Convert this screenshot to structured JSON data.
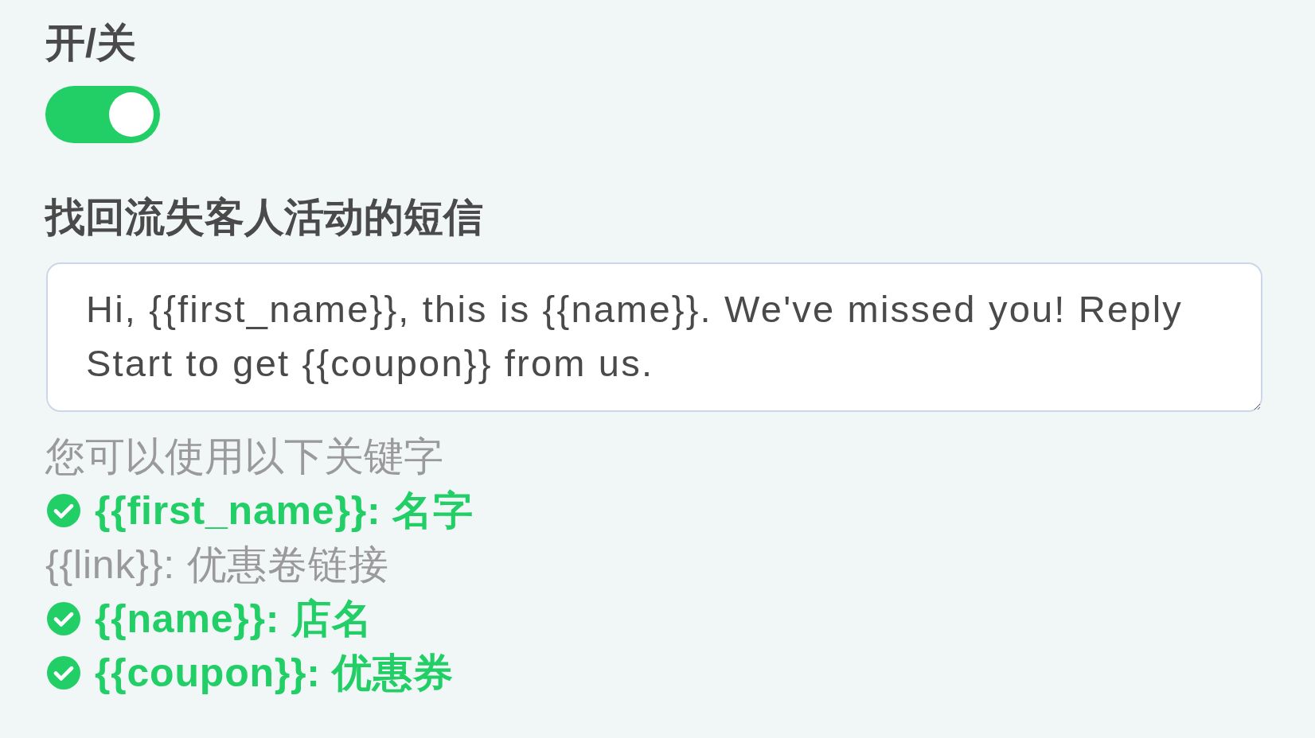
{
  "toggle": {
    "label": "开/关",
    "on": true
  },
  "message": {
    "label": "找回流失客人活动的短信",
    "value": "Hi, {{first_name}}, this is {{name}}. We've missed you! Reply Start to get {{coupon}} from us."
  },
  "keywords": {
    "hint": "您可以使用以下关键字",
    "items": [
      {
        "text": "{{first_name}}: 名字",
        "checked": true
      },
      {
        "text": "{{link}}: 优惠卷链接",
        "checked": false
      },
      {
        "text": "{{name}}: 店名",
        "checked": true
      },
      {
        "text": "{{coupon}}: 优惠券",
        "checked": true
      }
    ]
  }
}
